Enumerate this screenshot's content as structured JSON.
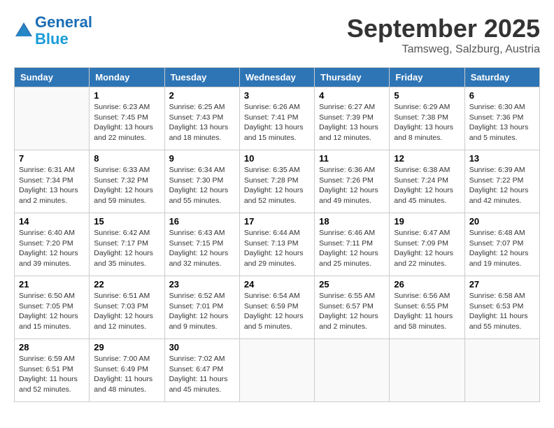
{
  "header": {
    "logo_line1": "General",
    "logo_line2": "Blue",
    "month": "September 2025",
    "location": "Tamsweg, Salzburg, Austria"
  },
  "weekdays": [
    "Sunday",
    "Monday",
    "Tuesday",
    "Wednesday",
    "Thursday",
    "Friday",
    "Saturday"
  ],
  "weeks": [
    [
      {
        "day": "",
        "info": ""
      },
      {
        "day": "1",
        "info": "Sunrise: 6:23 AM\nSunset: 7:45 PM\nDaylight: 13 hours\nand 22 minutes."
      },
      {
        "day": "2",
        "info": "Sunrise: 6:25 AM\nSunset: 7:43 PM\nDaylight: 13 hours\nand 18 minutes."
      },
      {
        "day": "3",
        "info": "Sunrise: 6:26 AM\nSunset: 7:41 PM\nDaylight: 13 hours\nand 15 minutes."
      },
      {
        "day": "4",
        "info": "Sunrise: 6:27 AM\nSunset: 7:39 PM\nDaylight: 13 hours\nand 12 minutes."
      },
      {
        "day": "5",
        "info": "Sunrise: 6:29 AM\nSunset: 7:38 PM\nDaylight: 13 hours\nand 8 minutes."
      },
      {
        "day": "6",
        "info": "Sunrise: 6:30 AM\nSunset: 7:36 PM\nDaylight: 13 hours\nand 5 minutes."
      }
    ],
    [
      {
        "day": "7",
        "info": "Sunrise: 6:31 AM\nSunset: 7:34 PM\nDaylight: 13 hours\nand 2 minutes."
      },
      {
        "day": "8",
        "info": "Sunrise: 6:33 AM\nSunset: 7:32 PM\nDaylight: 12 hours\nand 59 minutes."
      },
      {
        "day": "9",
        "info": "Sunrise: 6:34 AM\nSunset: 7:30 PM\nDaylight: 12 hours\nand 55 minutes."
      },
      {
        "day": "10",
        "info": "Sunrise: 6:35 AM\nSunset: 7:28 PM\nDaylight: 12 hours\nand 52 minutes."
      },
      {
        "day": "11",
        "info": "Sunrise: 6:36 AM\nSunset: 7:26 PM\nDaylight: 12 hours\nand 49 minutes."
      },
      {
        "day": "12",
        "info": "Sunrise: 6:38 AM\nSunset: 7:24 PM\nDaylight: 12 hours\nand 45 minutes."
      },
      {
        "day": "13",
        "info": "Sunrise: 6:39 AM\nSunset: 7:22 PM\nDaylight: 12 hours\nand 42 minutes."
      }
    ],
    [
      {
        "day": "14",
        "info": "Sunrise: 6:40 AM\nSunset: 7:20 PM\nDaylight: 12 hours\nand 39 minutes."
      },
      {
        "day": "15",
        "info": "Sunrise: 6:42 AM\nSunset: 7:17 PM\nDaylight: 12 hours\nand 35 minutes."
      },
      {
        "day": "16",
        "info": "Sunrise: 6:43 AM\nSunset: 7:15 PM\nDaylight: 12 hours\nand 32 minutes."
      },
      {
        "day": "17",
        "info": "Sunrise: 6:44 AM\nSunset: 7:13 PM\nDaylight: 12 hours\nand 29 minutes."
      },
      {
        "day": "18",
        "info": "Sunrise: 6:46 AM\nSunset: 7:11 PM\nDaylight: 12 hours\nand 25 minutes."
      },
      {
        "day": "19",
        "info": "Sunrise: 6:47 AM\nSunset: 7:09 PM\nDaylight: 12 hours\nand 22 minutes."
      },
      {
        "day": "20",
        "info": "Sunrise: 6:48 AM\nSunset: 7:07 PM\nDaylight: 12 hours\nand 19 minutes."
      }
    ],
    [
      {
        "day": "21",
        "info": "Sunrise: 6:50 AM\nSunset: 7:05 PM\nDaylight: 12 hours\nand 15 minutes."
      },
      {
        "day": "22",
        "info": "Sunrise: 6:51 AM\nSunset: 7:03 PM\nDaylight: 12 hours\nand 12 minutes."
      },
      {
        "day": "23",
        "info": "Sunrise: 6:52 AM\nSunset: 7:01 PM\nDaylight: 12 hours\nand 9 minutes."
      },
      {
        "day": "24",
        "info": "Sunrise: 6:54 AM\nSunset: 6:59 PM\nDaylight: 12 hours\nand 5 minutes."
      },
      {
        "day": "25",
        "info": "Sunrise: 6:55 AM\nSunset: 6:57 PM\nDaylight: 12 hours\nand 2 minutes."
      },
      {
        "day": "26",
        "info": "Sunrise: 6:56 AM\nSunset: 6:55 PM\nDaylight: 11 hours\nand 58 minutes."
      },
      {
        "day": "27",
        "info": "Sunrise: 6:58 AM\nSunset: 6:53 PM\nDaylight: 11 hours\nand 55 minutes."
      }
    ],
    [
      {
        "day": "28",
        "info": "Sunrise: 6:59 AM\nSunset: 6:51 PM\nDaylight: 11 hours\nand 52 minutes."
      },
      {
        "day": "29",
        "info": "Sunrise: 7:00 AM\nSunset: 6:49 PM\nDaylight: 11 hours\nand 48 minutes."
      },
      {
        "day": "30",
        "info": "Sunrise: 7:02 AM\nSunset: 6:47 PM\nDaylight: 11 hours\nand 45 minutes."
      },
      {
        "day": "",
        "info": ""
      },
      {
        "day": "",
        "info": ""
      },
      {
        "day": "",
        "info": ""
      },
      {
        "day": "",
        "info": ""
      }
    ]
  ]
}
